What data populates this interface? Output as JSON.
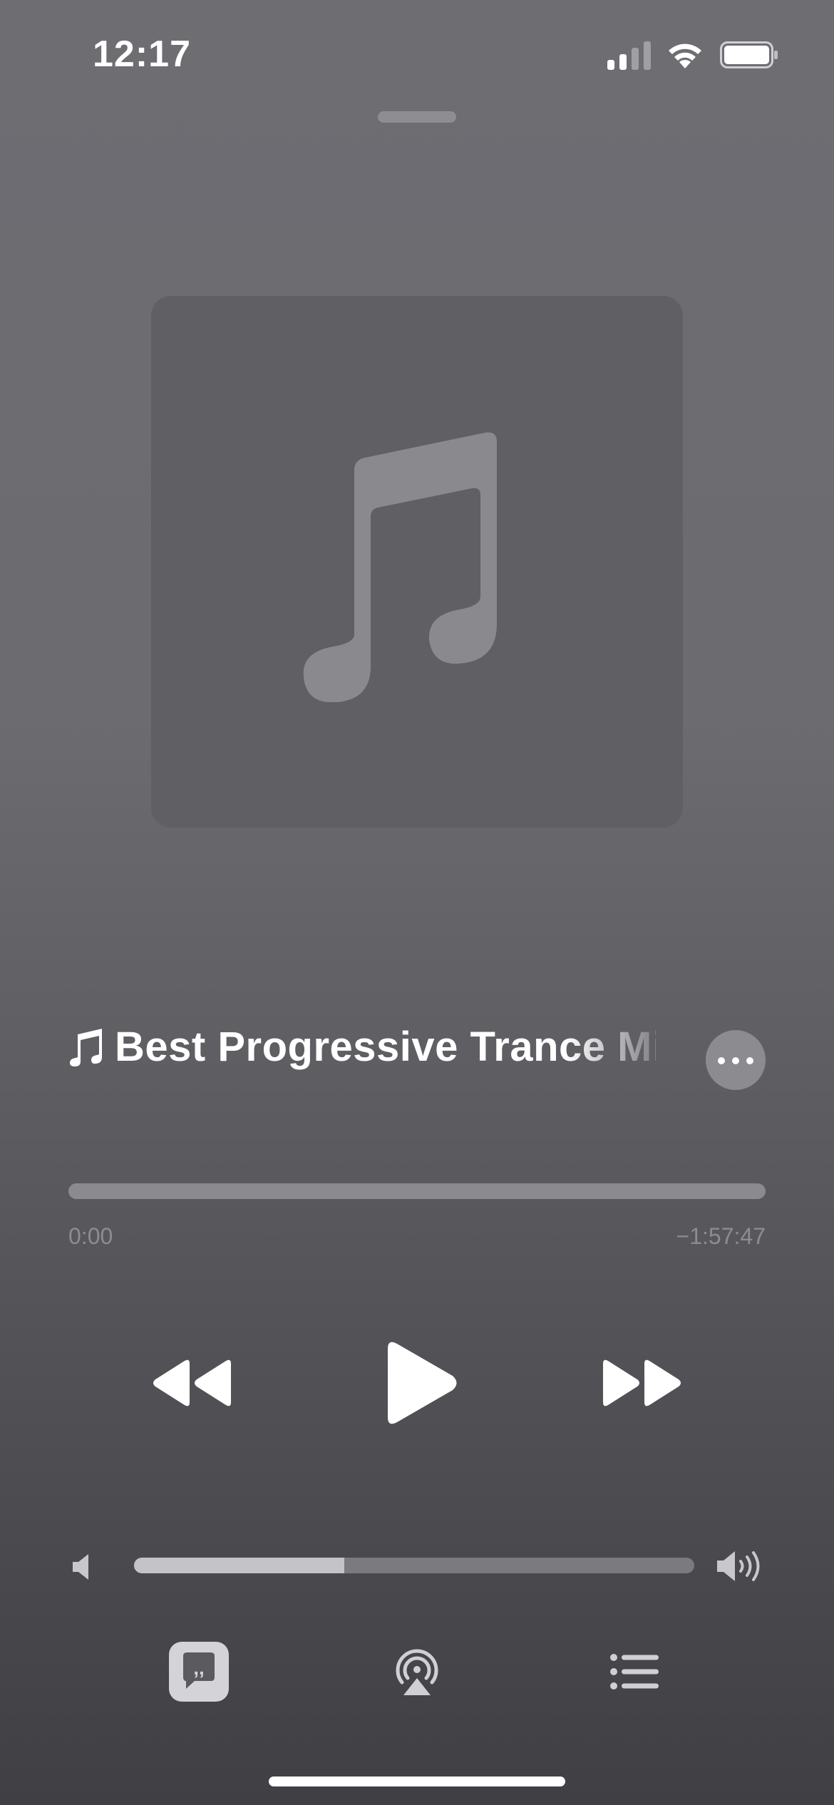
{
  "status_bar": {
    "time": "12:17",
    "signal_icon": "cellular-signal-icon",
    "wifi_icon": "wifi-icon",
    "battery_icon": "battery-icon"
  },
  "artwork": {
    "placeholder_icon": "music-note-icon"
  },
  "now_playing": {
    "title": "Best Progressive Trance Mi",
    "title_icon": "music-note-icon",
    "more_icon": "ellipsis-icon"
  },
  "progress": {
    "elapsed": "0:00",
    "remaining": "−1:57:47",
    "fraction": 0
  },
  "controls": {
    "rewind_icon": "rewind-icon",
    "play_icon": "play-icon",
    "forward_icon": "fast-forward-icon"
  },
  "volume": {
    "level": 0.375,
    "low_icon": "speaker-low-icon",
    "high_icon": "speaker-high-icon"
  },
  "bottom_bar": {
    "lyrics_icon": "lyrics-quote-icon",
    "airplay_icon": "airplay-icon",
    "queue_icon": "queue-list-icon"
  },
  "colors": {
    "background_top": "#6d6d72",
    "background_bottom": "#3f3f44",
    "artwork_bg": "#5f5f64",
    "accent": "#ffffff"
  }
}
